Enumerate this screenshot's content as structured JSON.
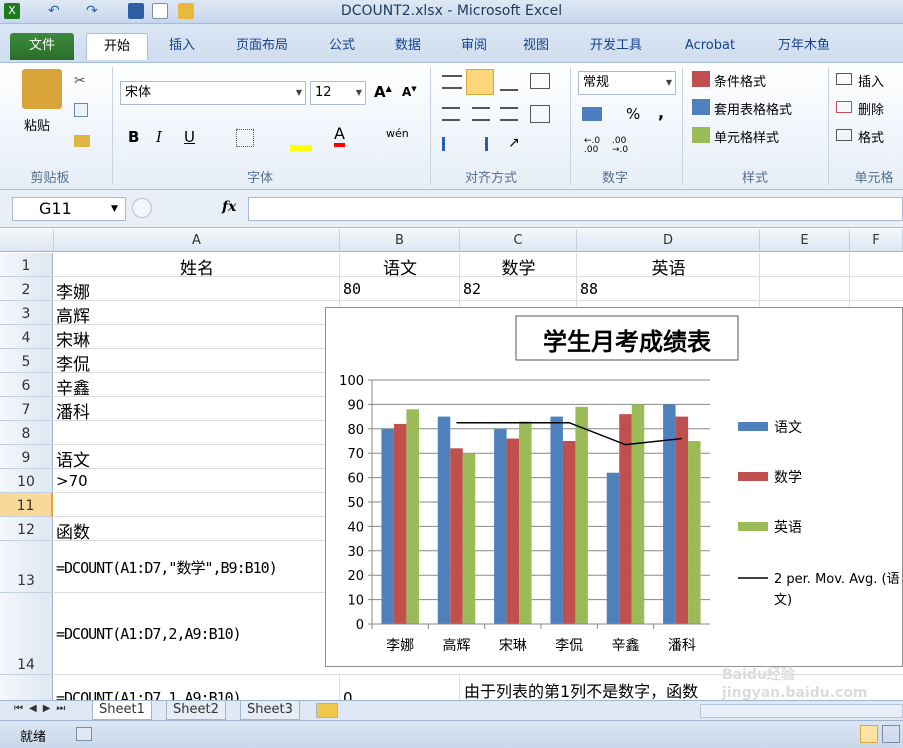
{
  "window": {
    "title": "DCOUNT2.xlsx - Microsoft Excel"
  },
  "tabs": [
    "文件",
    "开始",
    "插入",
    "页面布局",
    "公式",
    "数据",
    "审阅",
    "视图",
    "开发工具",
    "Acrobat",
    "万年木鱼"
  ],
  "ribbon": {
    "clipboard": {
      "paste": "粘贴",
      "label": "剪贴板"
    },
    "font": {
      "name": "宋体",
      "size": "12",
      "label": "字体",
      "bold": "B",
      "italic": "I",
      "underline": "U",
      "font_color": "A",
      "phonetic": "wén"
    },
    "alignment": {
      "label": "对齐方式"
    },
    "number": {
      "format": "常规",
      "percent": "%",
      "comma": ",",
      "label": "数字"
    },
    "styles": {
      "conditional": "条件格式",
      "table": "套用表格格式",
      "cell": "单元格样式",
      "label": "样式"
    },
    "cells": {
      "insert": "插入",
      "delete": "删除",
      "format": "格式",
      "label": "单元格"
    }
  },
  "formula_bar": {
    "name_box": "G11",
    "fx": "fx",
    "formula": ""
  },
  "columns": [
    "A",
    "B",
    "C",
    "D",
    "E",
    "F"
  ],
  "rows": [
    "1",
    "2",
    "3",
    "4",
    "5",
    "6",
    "7",
    "8",
    "9",
    "10",
    "11",
    "12",
    "13",
    "14"
  ],
  "cells": {
    "A1": "姓名",
    "B1": "语文",
    "C1": "数学",
    "D1": "英语",
    "A2": "李娜",
    "B2": "80",
    "C2": "82",
    "D2": "88",
    "A3": "高辉",
    "A4": "宋琳",
    "A5": "李侃",
    "A6": "辛鑫",
    "A7": "潘科",
    "A9": "语文",
    "A10": ">70",
    "A12": "函数",
    "A13": "=DCOUNT(A1:D7,\"数学\",B9:B10)",
    "A14": "=DCOUNT(A1:D7,2,A9:B10)",
    "A15": "=DCOUNT(A1:D7,1,A9:B10)",
    "B15": "0",
    "C15": "由于列表的第1列不是数字，函数"
  },
  "sheets": [
    "Sheet1",
    "Sheet2",
    "Sheet3"
  ],
  "status": {
    "ready": "就绪"
  },
  "watermark": "Baidu经验 jingyan.baidu.com",
  "chart_data": {
    "type": "bar",
    "title": "学生月考成绩表",
    "categories": [
      "李娜",
      "高辉",
      "宋琳",
      "李侃",
      "辛鑫",
      "潘科"
    ],
    "series": [
      {
        "name": "语文",
        "values": [
          80,
          85,
          80,
          85,
          62,
          90
        ],
        "color": "#4f81bd"
      },
      {
        "name": "数学",
        "values": [
          82,
          72,
          76,
          75,
          86,
          85
        ],
        "color": "#c0504d"
      },
      {
        "name": "英语",
        "values": [
          88,
          70,
          83,
          89,
          90,
          75
        ],
        "color": "#9bbb59"
      }
    ],
    "trendline": {
      "name": "2 per. Mov. Avg. (语文)",
      "values": [
        null,
        82.5,
        82.5,
        82.5,
        73.5,
        76
      ],
      "color": "#000000"
    },
    "ylim": [
      0,
      100
    ],
    "yticks": [
      "0",
      "10",
      "20",
      "30",
      "40",
      "50",
      "60",
      "70",
      "80",
      "90",
      "100"
    ],
    "grid": true,
    "legend": "right"
  }
}
